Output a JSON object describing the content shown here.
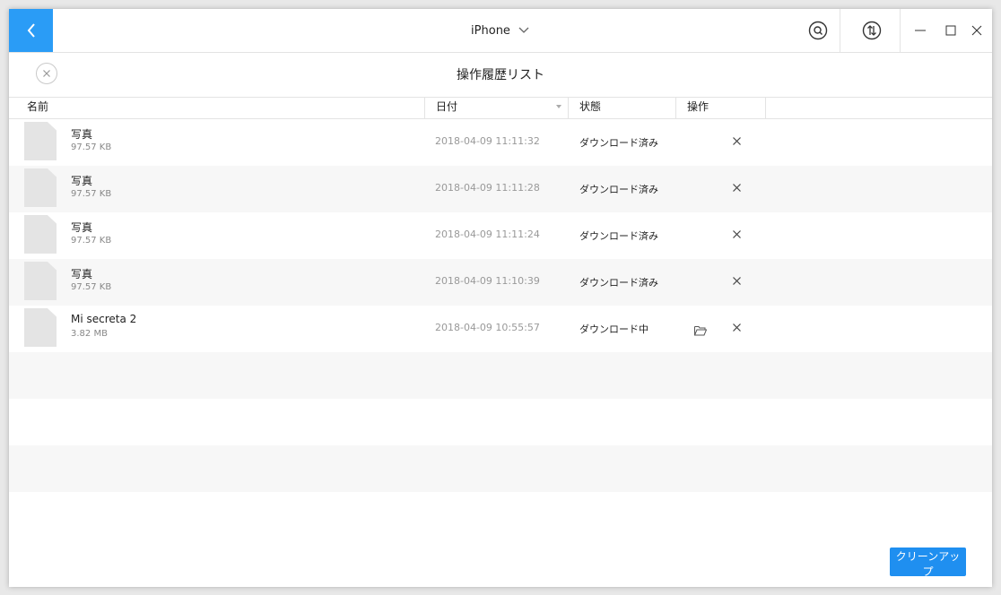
{
  "header": {
    "device_name": "iPhone"
  },
  "subheader": {
    "title": "操作履歴リスト"
  },
  "table": {
    "columns": [
      "名前",
      "日付",
      "状態",
      "操作"
    ],
    "rows": [
      {
        "name": "写真",
        "size": "97.57 KB",
        "date": "2018-04-09 11:11:32",
        "status": "ダウンロード済み",
        "has_folder": false
      },
      {
        "name": "写真",
        "size": "97.57 KB",
        "date": "2018-04-09 11:11:28",
        "status": "ダウンロード済み",
        "has_folder": false
      },
      {
        "name": "写真",
        "size": "97.57 KB",
        "date": "2018-04-09 11:11:24",
        "status": "ダウンロード済み",
        "has_folder": false
      },
      {
        "name": "写真",
        "size": "97.57 KB",
        "date": "2018-04-09 11:10:39",
        "status": "ダウンロード済み",
        "has_folder": false
      },
      {
        "name": "Mi secreta 2",
        "size": "3.82 MB",
        "date": "2018-04-09 10:55:57",
        "status": "ダウンロード中",
        "has_folder": true
      }
    ],
    "empty_rows": 3
  },
  "footer": {
    "cleanup_label": "クリーンアップ"
  },
  "colors": {
    "accent": "#2a9cf6",
    "button": "#1f8ff0",
    "alt_row": "#f7f7f7"
  },
  "icons": {
    "back": "chevron-left-icon",
    "device_dropdown": "chevron-down-icon",
    "search": "search-icon",
    "transfer": "transfer-icon",
    "minimize": "minimize-icon",
    "maximize": "maximize-icon",
    "close": "close-icon",
    "folder": "folder-open-icon",
    "delete": "delete-x-icon"
  }
}
